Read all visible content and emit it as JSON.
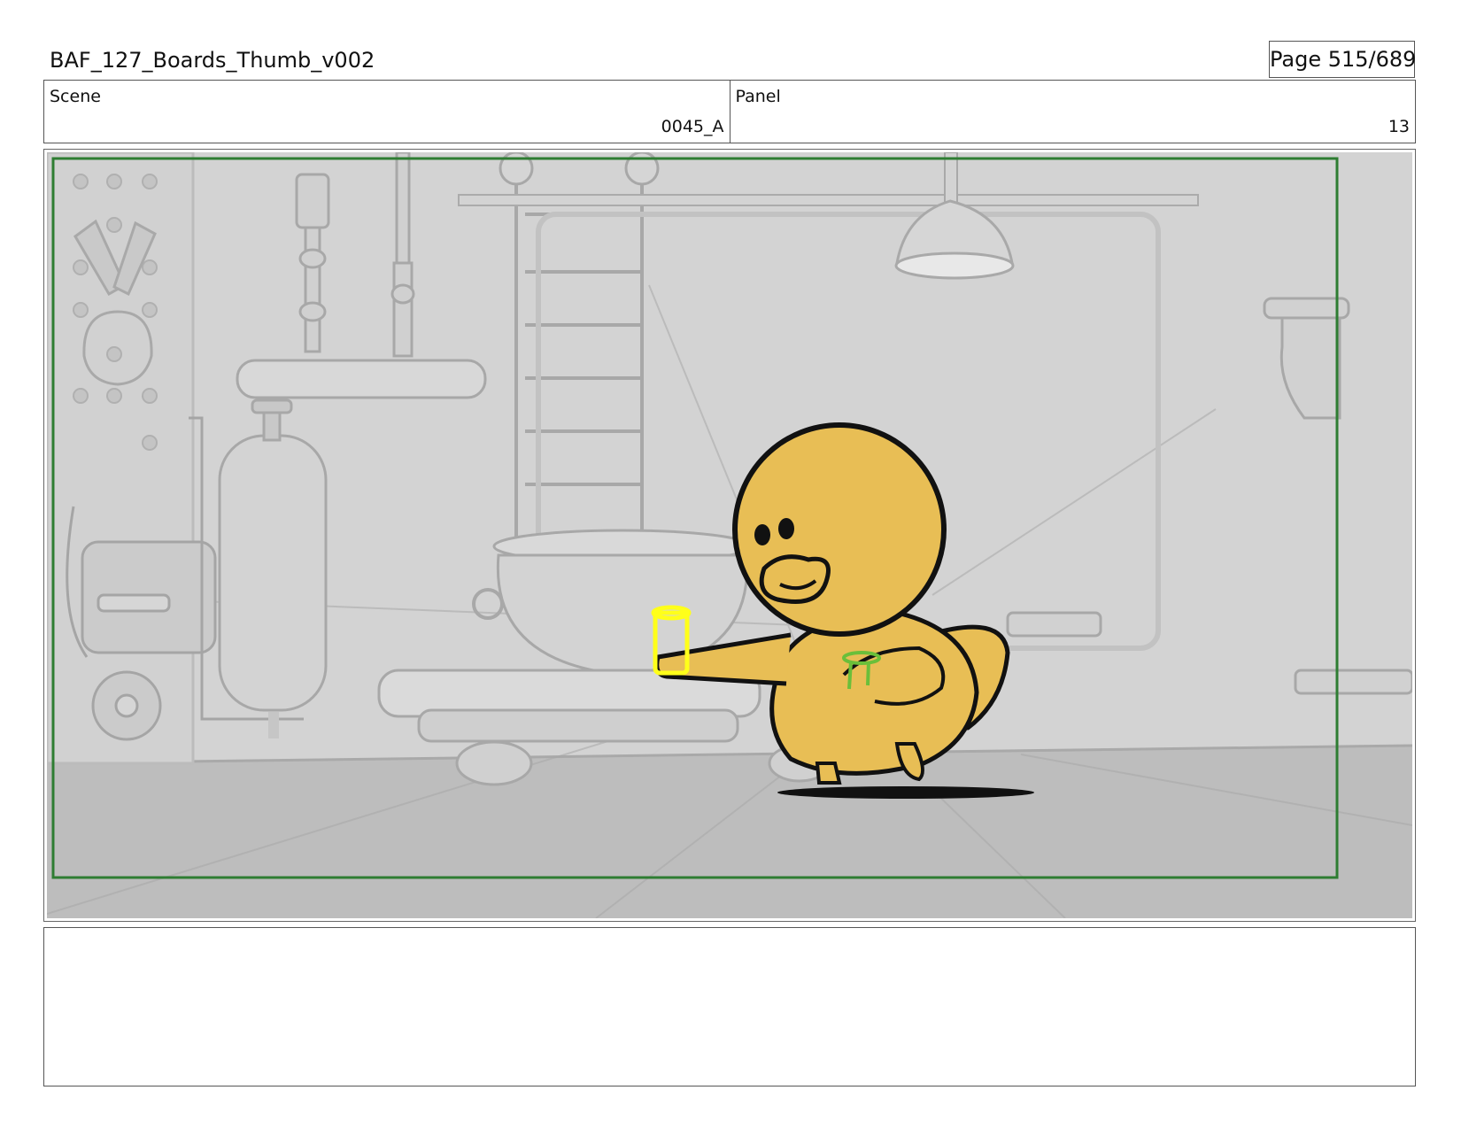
{
  "header": {
    "title": "BAF_127_Boards_Thumb_v002",
    "page": "Page 515/689"
  },
  "info": {
    "scene_label": "Scene",
    "scene_value": "0045_A",
    "panel_label": "Panel",
    "panel_value": "13"
  },
  "panel": {
    "image_subject": "grey lab background with yellow duck character holding a glass",
    "safe_frame_color": "#2e7d32",
    "character_color": "#e8be55",
    "glass_color": "#ffff1a",
    "liquid_color": "#6abf3a"
  },
  "notes": {
    "text": ""
  }
}
